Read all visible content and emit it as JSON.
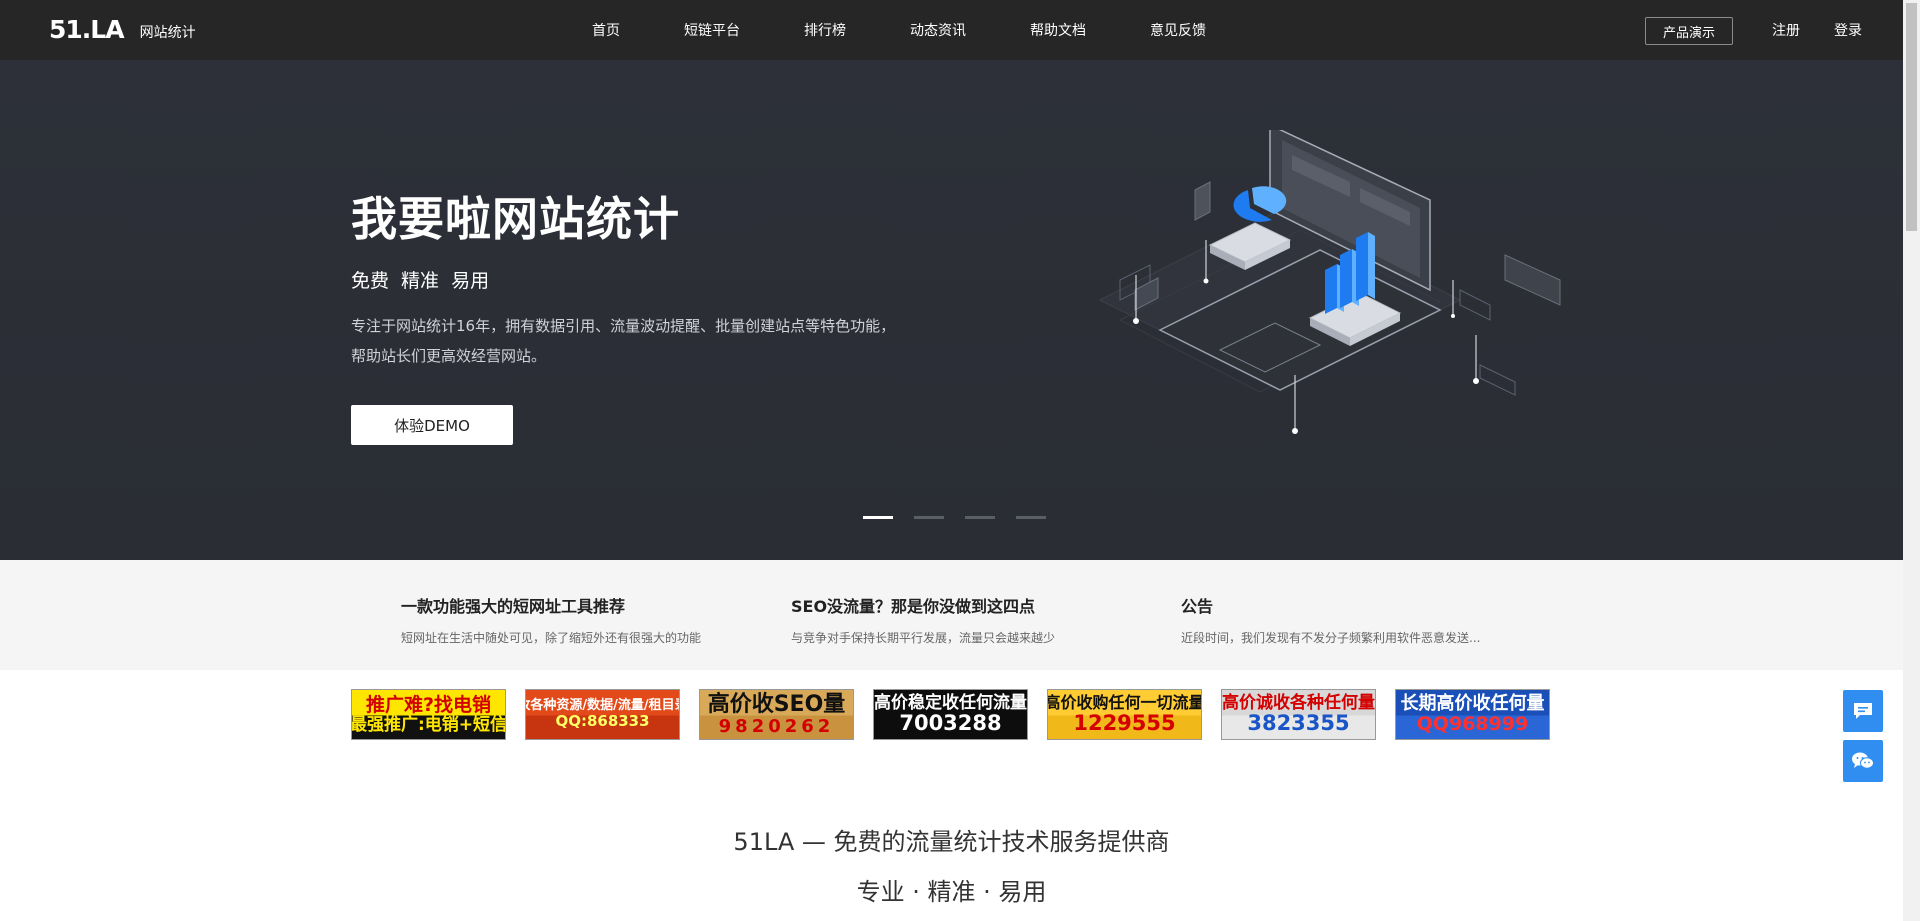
{
  "nav": {
    "logo": "51.LA",
    "logo_text": "网站统计",
    "menu": [
      "首页",
      "短链平台",
      "排行榜",
      "动态资讯",
      "帮助文档",
      "意见反馈"
    ],
    "demo": "产品演示",
    "register": "注册",
    "login": "登录"
  },
  "hero": {
    "title": "我要啦网站统计",
    "subtitle": "免费 精准 易用",
    "desc_line1": "专注于网站统计16年，拥有数据引用、流量波动提醒、批量创建站点等特色功能，",
    "desc_line2": "帮助站长们更高效经营网站。",
    "cta": "体验DEMO",
    "slide_count": 4,
    "active_slide": 1
  },
  "news": [
    {
      "title": "一款功能强大的短网址工具推荐",
      "desc": "短网址在生活中随处可见，除了缩短外还有很强大的功能"
    },
    {
      "title": "SEO没流量？那是你没做到这四点",
      "desc": "与竞争对手保持长期平行发展，流量只会越来越少"
    },
    {
      "title": "公告",
      "desc": "近段时间，我们发现有不发分子频繁利用软件恶意发送..."
    }
  ],
  "ads": [
    {
      "line1": "推广难?找电销",
      "line2": "最强推广:电销+短信",
      "bg": "#ffe600",
      "c1": "#d40000",
      "c2": "#ffe600",
      "bg2": "#111111"
    },
    {
      "line1": "收各种资源/数据/流量/租目录",
      "line2": "QQ:868333",
      "bg": "#e24a1a",
      "c1": "#ffffff",
      "c2": "#ffff66",
      "bg2": "#c73410"
    },
    {
      "line1": "高价收SEO量",
      "line2": "9820262",
      "bg": "#d9a95a",
      "c1": "#111111",
      "c2": "#d40000",
      "bg2": "#c8923e"
    },
    {
      "line1": "高价稳定收任何流量",
      "line2": "7003288",
      "bg": "#0d0d0d",
      "c1": "#ffffff",
      "c2": "#ffffff",
      "bg2": "#0d0d0d"
    },
    {
      "line1": "高价收购任何一切流量",
      "line2": "1229555",
      "bg": "#ffcc33",
      "c1": "#111111",
      "c2": "#d40000",
      "bg2": "#f0b818"
    },
    {
      "line1": "高价诚收各种任何量",
      "line2": "3823355",
      "bg": "#d8d8d8",
      "c1": "#d40000",
      "c2": "#1a55c8",
      "bg2": "#e8e8e8"
    },
    {
      "line1": "长期高价收任何量",
      "line2": "QQ968999",
      "bg": "#1a4fb8",
      "c1": "#ffffff",
      "c2": "#ff3030",
      "bg2": "#2a66d6"
    }
  ],
  "slogan": {
    "line1": "51LA — 免费的流量统计技术服务提供商",
    "line2": "专业 · 精准 · 易用"
  },
  "float": {
    "chat_icon": "chat-icon",
    "wechat_icon": "wechat-icon"
  },
  "colors": {
    "nav_bg": "#262626",
    "hero_bg": "#2d3038",
    "accent_blue": "#2f8ef0"
  }
}
